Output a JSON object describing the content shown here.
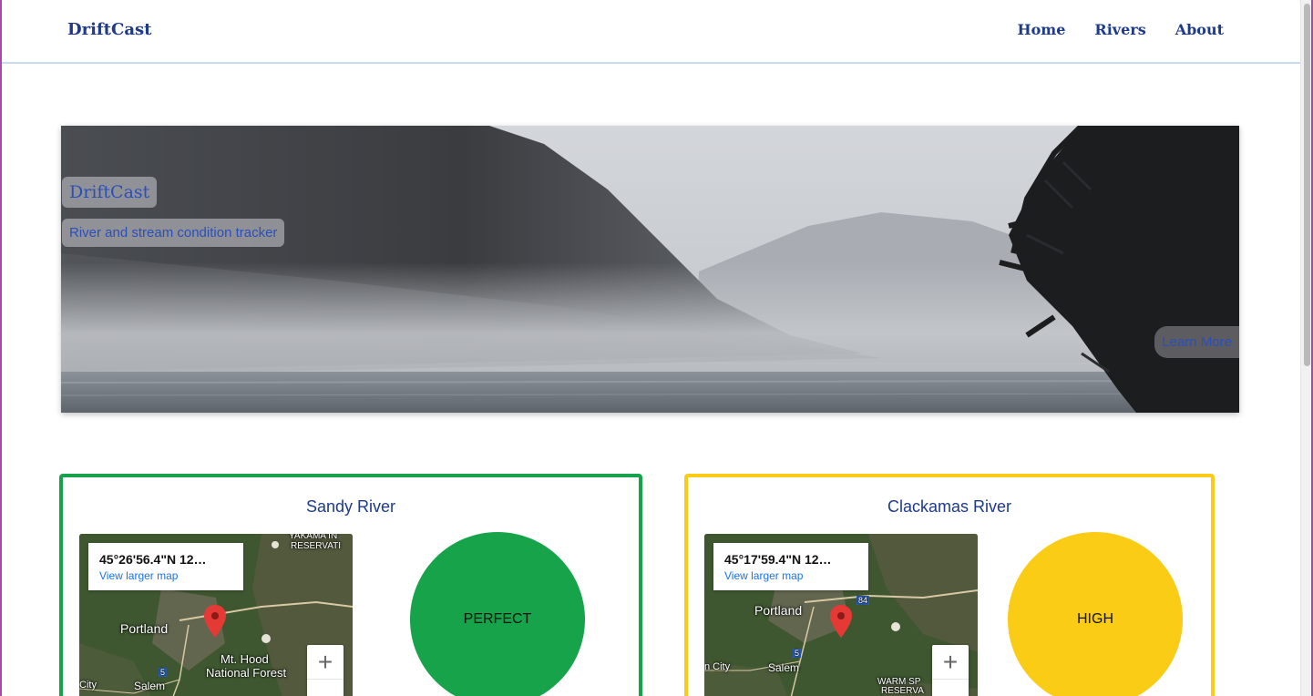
{
  "app": {
    "brand": "DriftCast"
  },
  "nav": {
    "links": [
      "Home",
      "Rivers",
      "About"
    ]
  },
  "hero": {
    "title": "DriftCast",
    "subtitle": "River and stream condition tracker",
    "button": "Learn More"
  },
  "rivers": [
    {
      "name": "Sandy River",
      "status": "PERFECT",
      "color": "#16a34a",
      "map": {
        "coords": "45°26'56.4\"N 12…",
        "link": "View larger map",
        "labels": [
          "Portland",
          "Mt. Hood",
          "National Forest",
          "Salem",
          "City",
          "YAKAMA IN",
          "RESERVATI",
          "5"
        ]
      }
    },
    {
      "name": "Clackamas River",
      "status": "HIGH",
      "color": "#facc15",
      "map": {
        "coords": "45°17'59.4\"N 12…",
        "link": "View larger map",
        "labels": [
          "Portland",
          "n City",
          "Salem",
          "WARM SP",
          "RESERVA",
          "84",
          "5"
        ]
      }
    }
  ],
  "map_controls": {
    "zoom_in": "+"
  },
  "colors": {
    "brand": "#1e3a8a",
    "link": "#1a73e8",
    "perfect": "#16a34a",
    "high": "#facc15"
  }
}
